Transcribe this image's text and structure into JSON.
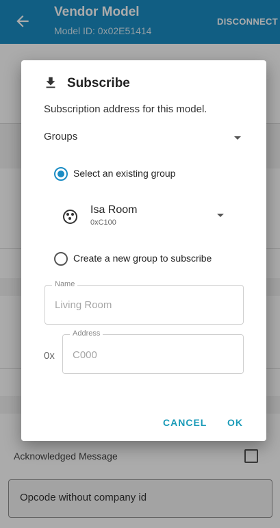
{
  "appbar": {
    "title": "Vendor Model",
    "subtitle": "Model ID: 0x02E51414",
    "action": "DISCONNECT",
    "back_icon": "arrow-back-icon",
    "color": "#1a8cc4"
  },
  "background": {
    "ack_label": "Acknowledged Message",
    "opcode_placeholder": "Opcode without company id"
  },
  "dialog": {
    "icon": "download-icon",
    "title": "Subscribe",
    "description": "Subscription address for this model.",
    "address_type": "Groups",
    "option_existing": "Select an existing group",
    "existing_selected": true,
    "group": {
      "name": "Isa Room",
      "address": "0xC100",
      "icon": "group-icon"
    },
    "option_new": "Create a new group to subscribe",
    "new_selected": false,
    "name_field": {
      "label": "Name",
      "placeholder": "Living Room"
    },
    "address_field": {
      "label": "Address",
      "prefix": "0x",
      "placeholder": "C000"
    },
    "cancel": "CANCEL",
    "ok": "OK",
    "accent": "#1a9bb8"
  }
}
